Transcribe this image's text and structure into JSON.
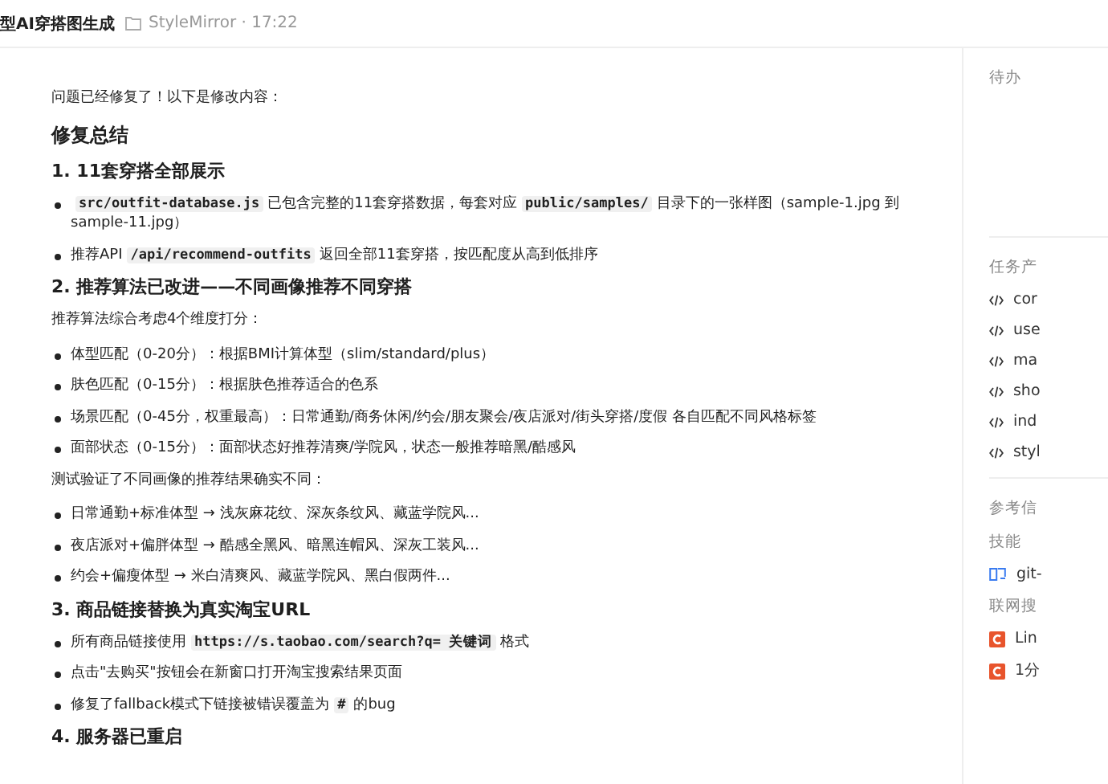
{
  "header": {
    "title": "型AI穿搭图生成",
    "project": "StyleMirror · 17:22"
  },
  "content": [
    {
      "kind": "p",
      "segments": [
        {
          "kind": "text",
          "text": "问题已经修复了！以下是修改内容："
        }
      ]
    },
    {
      "kind": "h1",
      "segments": [
        {
          "kind": "text",
          "text": "修复总结"
        }
      ]
    },
    {
      "kind": "h2",
      "segments": [
        {
          "kind": "text",
          "text": "1. 11套穿搭全部展示"
        }
      ]
    },
    {
      "kind": "li",
      "segments": [
        {
          "kind": "code",
          "text": "src/outfit-database.js"
        },
        {
          "kind": "text",
          "text": "已包含完整的11套穿搭数据，每套对应"
        },
        {
          "kind": "code",
          "text": "public/samples/"
        },
        {
          "kind": "text",
          "text": "目录下的一张样图（sample-1.jpg 到 sample-11.jpg）"
        }
      ]
    },
    {
      "kind": "li",
      "segments": [
        {
          "kind": "text",
          "text": "推荐API"
        },
        {
          "kind": "code",
          "text": "/api/recommend-outfits"
        },
        {
          "kind": "text",
          "text": "返回全部11套穿搭，按匹配度从高到低排序"
        }
      ]
    },
    {
      "kind": "h2",
      "segments": [
        {
          "kind": "text",
          "text": "2. 推荐算法已改进——不同画像推荐不同穿搭"
        }
      ]
    },
    {
      "kind": "p",
      "segments": [
        {
          "kind": "text",
          "text": "推荐算法综合考虑4个维度打分："
        }
      ]
    },
    {
      "kind": "li",
      "segments": [
        {
          "kind": "text",
          "text": "体型匹配（0-20分）：根据BMI计算体型（slim/standard/plus）"
        }
      ]
    },
    {
      "kind": "li",
      "segments": [
        {
          "kind": "text",
          "text": "肤色匹配（0-15分）：根据肤色推荐适合的色系"
        }
      ]
    },
    {
      "kind": "li",
      "segments": [
        {
          "kind": "text",
          "text": "场景匹配（0-45分，权重最高）：日常通勤/商务休闲/约会/朋友聚会/夜店派对/街头穿搭/度假 各自匹配不同风格标签"
        }
      ]
    },
    {
      "kind": "li",
      "segments": [
        {
          "kind": "text",
          "text": "面部状态（0-15分）：面部状态好推荐清爽/学院风，状态一般推荐暗黑/酷感风"
        }
      ]
    },
    {
      "kind": "p",
      "segments": [
        {
          "kind": "text",
          "text": "测试验证了不同画像的推荐结果确实不同："
        }
      ]
    },
    {
      "kind": "li",
      "segments": [
        {
          "kind": "text",
          "text": "日常通勤+标准体型 → 浅灰麻花纹、深灰条纹风、藏蓝学院风..."
        }
      ]
    },
    {
      "kind": "li",
      "segments": [
        {
          "kind": "text",
          "text": "夜店派对+偏胖体型 → 酷感全黑风、暗黑连帽风、深灰工装风..."
        }
      ]
    },
    {
      "kind": "li",
      "segments": [
        {
          "kind": "text",
          "text": "约会+偏瘦体型 → 米白清爽风、藏蓝学院风、黑白假两件..."
        }
      ]
    },
    {
      "kind": "h2",
      "segments": [
        {
          "kind": "text",
          "text": "3. 商品链接替换为真实淘宝URL"
        }
      ]
    },
    {
      "kind": "li",
      "segments": [
        {
          "kind": "text",
          "text": "所有商品链接使用"
        },
        {
          "kind": "code",
          "text": "https://s.taobao.com/search?q= 关键词"
        },
        {
          "kind": "text",
          "text": "格式"
        }
      ]
    },
    {
      "kind": "li",
      "segments": [
        {
          "kind": "text",
          "text": "点击\"去购买\"按钮会在新窗口打开淘宝搜索结果页面"
        }
      ]
    },
    {
      "kind": "li",
      "segments": [
        {
          "kind": "text",
          "text": "修复了fallback模式下链接被错误覆盖为"
        },
        {
          "kind": "code",
          "text": "#"
        },
        {
          "kind": "text",
          "text": "的bug"
        }
      ]
    },
    {
      "kind": "h2",
      "segments": [
        {
          "kind": "text",
          "text": "4. 服务器已重启"
        }
      ]
    }
  ],
  "panel": {
    "todo_title": "待办",
    "artifacts_title": "任务产",
    "artifacts": [
      "cor",
      "use",
      "ma",
      "sho",
      "ind",
      "styl"
    ],
    "refs_title": "参考信",
    "skills_title": "技能",
    "skills": [
      "git-"
    ],
    "search_title": "联网搜",
    "searches": [
      "Lin",
      "1分"
    ]
  }
}
